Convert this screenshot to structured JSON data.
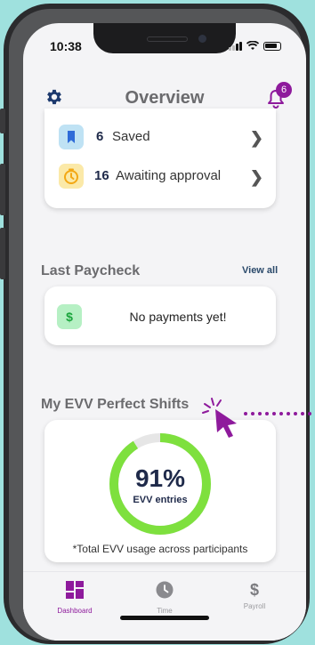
{
  "status": {
    "time": "10:38"
  },
  "header": {
    "title": "Overview",
    "notification_count": "6"
  },
  "tasks": [
    {
      "count": "6",
      "label": "Saved",
      "icon": "bookmark-icon",
      "color": "#2e6bd8",
      "bg": "#bfe2f4"
    },
    {
      "count": "16",
      "label": "Awaiting approval",
      "icon": "timer-icon",
      "color": "#f3b315",
      "bg": "#fbe9a8"
    }
  ],
  "last_paycheck": {
    "title": "Last Paycheck",
    "view_all": "View all",
    "empty_message": "No payments yet!",
    "icon_glyph": "$"
  },
  "evv": {
    "title": "My EVV Perfect Shifts",
    "percent": 91,
    "percent_label": "91%",
    "caption": "EVV entries",
    "footnote": "*Total EVV usage across participants",
    "ring_color": "#7ee03e",
    "track_color": "#e6e6e6"
  },
  "tabs": [
    {
      "label": "Dashboard",
      "icon": "dashboard-icon",
      "active": true
    },
    {
      "label": "Time",
      "icon": "clock-icon",
      "active": false
    },
    {
      "label": "Payroll",
      "icon": "dollar-icon",
      "active": false
    }
  ],
  "colors": {
    "accent": "#8e1a9c",
    "navy": "#2b4a6b"
  }
}
